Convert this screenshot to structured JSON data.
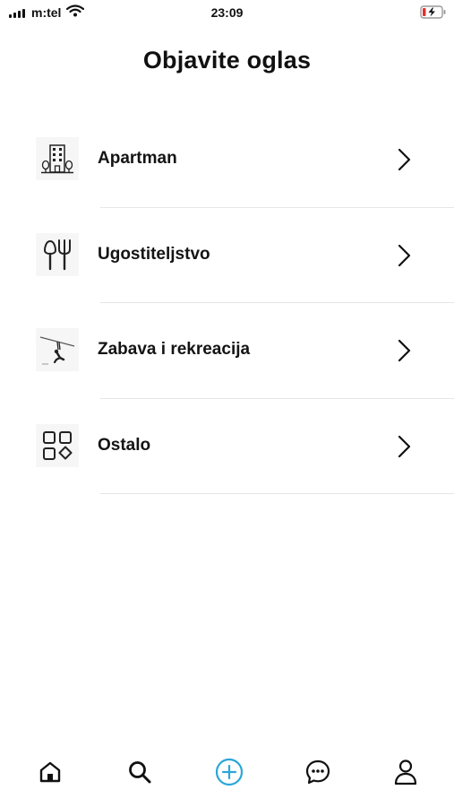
{
  "status_bar": {
    "carrier": "m:tel",
    "time": "23:09",
    "icons": [
      "signal-icon",
      "wifi-icon",
      "battery-charging-icon"
    ]
  },
  "header": {
    "title": "Objavite oglas"
  },
  "categories": [
    {
      "label": "Apartman",
      "icon": "apartment-building-icon"
    },
    {
      "label": "Ugostiteljstvo",
      "icon": "fork-spoon-icon"
    },
    {
      "label": "Zabava i rekreacija",
      "icon": "zipline-icon"
    },
    {
      "label": "Ostalo",
      "icon": "shapes-grid-icon"
    }
  ],
  "tab_bar": {
    "tabs": [
      {
        "icon": "home-icon"
      },
      {
        "icon": "search-icon"
      },
      {
        "icon": "add-circle-icon",
        "active": true
      },
      {
        "icon": "chat-icon"
      },
      {
        "icon": "profile-icon"
      }
    ]
  },
  "colors": {
    "accent": "#2ba6d9",
    "text": "#111111",
    "divider": "#e6e6e6",
    "battery_low": "#e0312b"
  }
}
